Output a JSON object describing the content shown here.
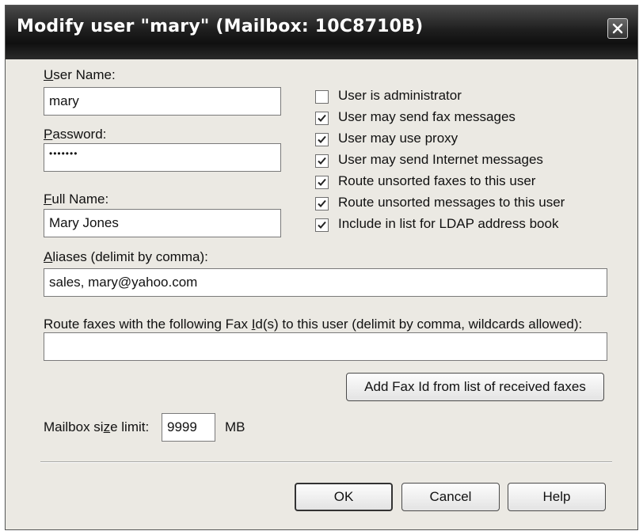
{
  "dialog": {
    "title": "Modify user \"mary\" (Mailbox: 10C8710B)"
  },
  "fields": {
    "user_name": {
      "label_ul": "U",
      "label_rest": "ser Name:",
      "value": "mary"
    },
    "password": {
      "label_ul": "P",
      "label_rest": "assword:",
      "value": "•••••••"
    },
    "full_name": {
      "label_ul": "F",
      "label_rest": "ull Name:",
      "value": "Mary Jones"
    },
    "aliases": {
      "label_ul": "A",
      "label_rest": "liases (delimit by comma):",
      "value": "sales, mary@yahoo.com"
    },
    "fax_ids": {
      "label_before": "Route faxes with the following Fax ",
      "label_ul": "I",
      "label_after": "d(s) to this user (delimit by comma, wildcards allowed):",
      "value": ""
    },
    "mailbox_limit": {
      "label_before": "Mailbox si",
      "label_ul": "z",
      "label_after": "e limit:",
      "value": "9999",
      "unit": "MB"
    }
  },
  "options": [
    {
      "label": "User is administrator",
      "checked": false
    },
    {
      "label": "User may send fax messages",
      "checked": true
    },
    {
      "label": "User may use proxy",
      "checked": true
    },
    {
      "label": "User may send Internet messages",
      "checked": true
    },
    {
      "label": "Route unsorted faxes to this user",
      "checked": true
    },
    {
      "label": "Route unsorted messages to this user",
      "checked": true
    },
    {
      "label": "Include in list for LDAP address book",
      "checked": true
    }
  ],
  "buttons": {
    "add_fax_id": "Add Fax Id from list of received faxes",
    "ok": "OK",
    "cancel": "Cancel",
    "help": "Help"
  }
}
